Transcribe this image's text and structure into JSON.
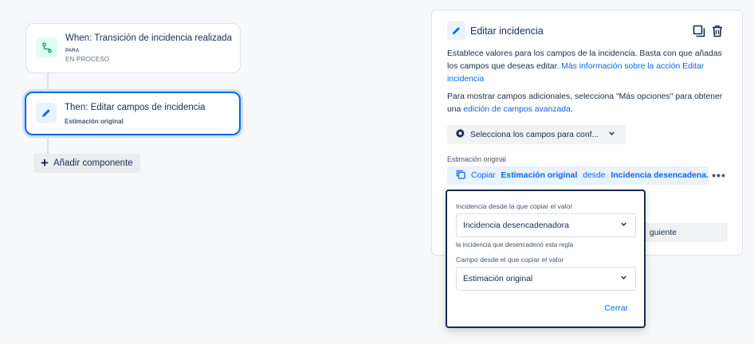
{
  "colors": {
    "accent": "#0c66e4",
    "text": "#172b4d",
    "subtle_text": "#44546f",
    "trigger_icon_bg": "#dcfff1",
    "trigger_icon_fg": "#22a06b",
    "action_icon_bg": "#e9f2ff",
    "selected_border": "#0c66e4"
  },
  "flow": {
    "trigger": {
      "title": "When: Transición de incidencia realizada",
      "to_label": "PARA",
      "to_value": "EN PROCESO",
      "icon": "branch-transition-icon"
    },
    "action": {
      "title": "Then: Editar campos de incidencia",
      "subtitle": "Estimación original",
      "icon": "pencil-icon"
    },
    "add_component_label": "Añadir componente"
  },
  "panel": {
    "title": "Editar incidencia",
    "description_prefix": "Establece valores para los campos de la incidencia. Basta con que añadas los campos que deseas editar. ",
    "description_link": "Más información sobre la acción Editar incidencia",
    "more_options_prefix": "Para mostrar campos adicionales, selecciona \"Más opciones\" para obtener una ",
    "more_options_link": "edición de campos avanzada",
    "more_options_suffix": ".",
    "select_fields_label": "Selecciona los campos para conf...",
    "field_label": "Estimación original",
    "copy_chip": {
      "prefix": "Copiar ",
      "field": "Estimación original",
      "middle": " desde ",
      "source": "Incidencia desencadena..."
    },
    "more_actions_label": "•••",
    "next_button_label": "guiente"
  },
  "popup": {
    "source_label": "Incidencia desde la que copiar el valor",
    "source_value": "Incidencia desencadenadora",
    "source_help": "la incidencia que desencadenó esta regla",
    "field_label": "Campo desde el que copiar el valor",
    "field_value": "Estimación original",
    "close_label": "Cerrar"
  }
}
